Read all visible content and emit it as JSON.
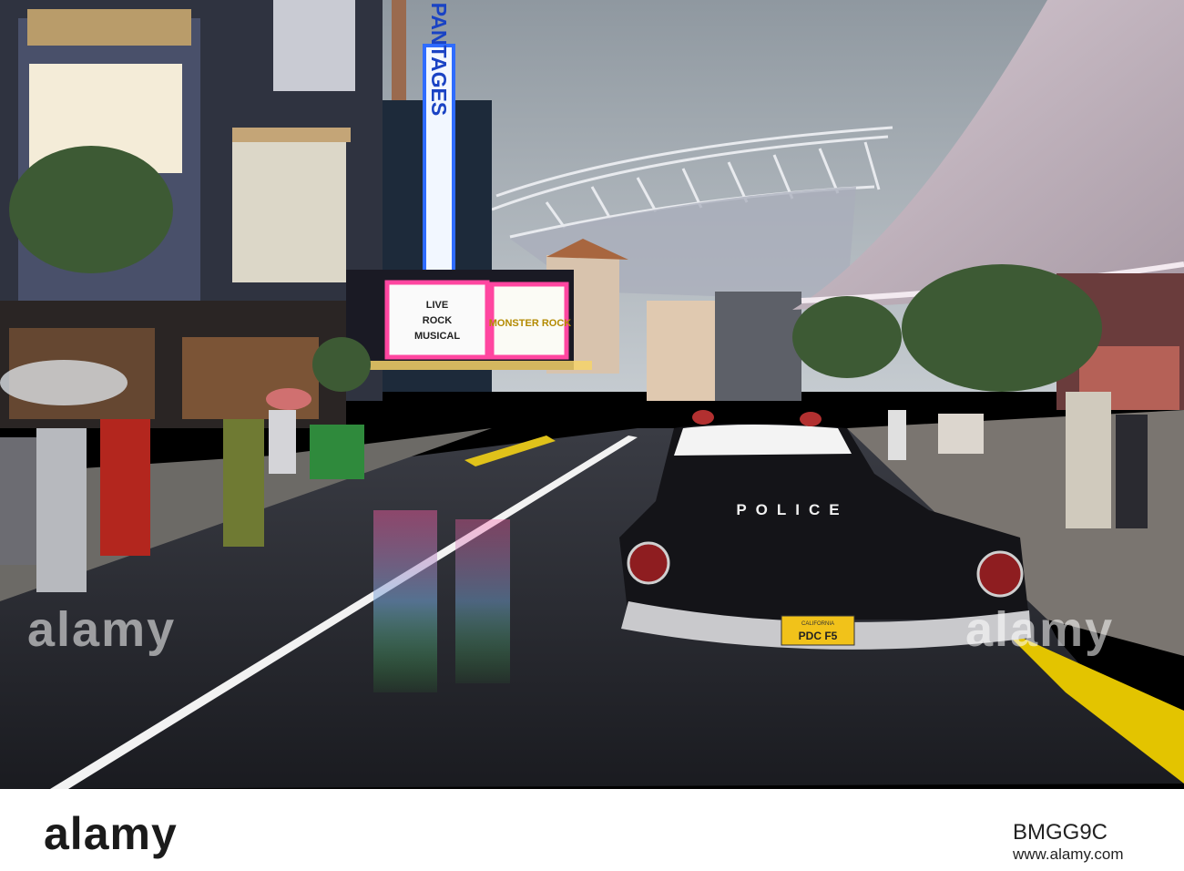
{
  "photo": {
    "theater_sign": "PANTAGES",
    "marquee_left": [
      "LIVE",
      "ROCK",
      "MUSICAL"
    ],
    "marquee_right": "MONSTER ROCK",
    "car_trunk_text": "POLICE",
    "plate_state": "CALIFORNIA",
    "plate_number": "PDC F5"
  },
  "watermark": {
    "left": "alamy",
    "right": "alamy"
  },
  "footer": {
    "logo": "alamy",
    "image_id": "BMGG9C",
    "url": "www.alamy.com"
  }
}
